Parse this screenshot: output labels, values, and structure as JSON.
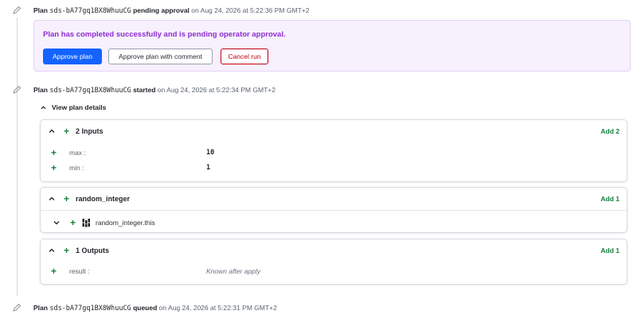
{
  "events": [
    {
      "prefix": "Plan",
      "id": "sds-bA77gq1BX8WhuuCG",
      "status": "pending approval",
      "on": "on",
      "timestamp": "Aug 24, 2026 at 5:22:36 PM GMT+2"
    },
    {
      "prefix": "Plan",
      "id": "sds-bA77gq1BX8WhuuCG",
      "status": "started",
      "on": "on",
      "timestamp": "Aug 24, 2026 at 5:22:34 PM GMT+2"
    },
    {
      "prefix": "Plan",
      "id": "sds-bA77gq1BX8WhuuCG",
      "status": "queued",
      "on": "on",
      "timestamp": "Aug 24, 2026 at 5:22:31 PM GMT+2"
    }
  ],
  "approval": {
    "message": "Plan has completed successfully and is pending operator approval.",
    "approve_label": "Approve plan",
    "approve_comment_label": "Approve plan with comment",
    "cancel_label": "Cancel run"
  },
  "details": {
    "toggle_label": "View plan details",
    "inputs": {
      "title": "2 Inputs",
      "add": "Add 2",
      "rows": [
        {
          "key": "max :",
          "value": "10"
        },
        {
          "key": "min :",
          "value": "1"
        }
      ]
    },
    "resource": {
      "title": "random_integer",
      "add": "Add 1",
      "item": "random_integer.this"
    },
    "outputs": {
      "title": "1 Outputs",
      "add": "Add 1",
      "rows": [
        {
          "key": "result :",
          "value": "Known after apply"
        }
      ]
    }
  },
  "colors": {
    "accent": "#1463ff",
    "success": "#15803d",
    "danger": "#c00011",
    "approval_text": "#8c2dd0",
    "approval_bg": "#f7f0fd"
  },
  "icons": [
    "pencil-icon",
    "chevron-up-icon",
    "chevron-down-icon",
    "plus-icon",
    "terraform-resource-icon"
  ]
}
